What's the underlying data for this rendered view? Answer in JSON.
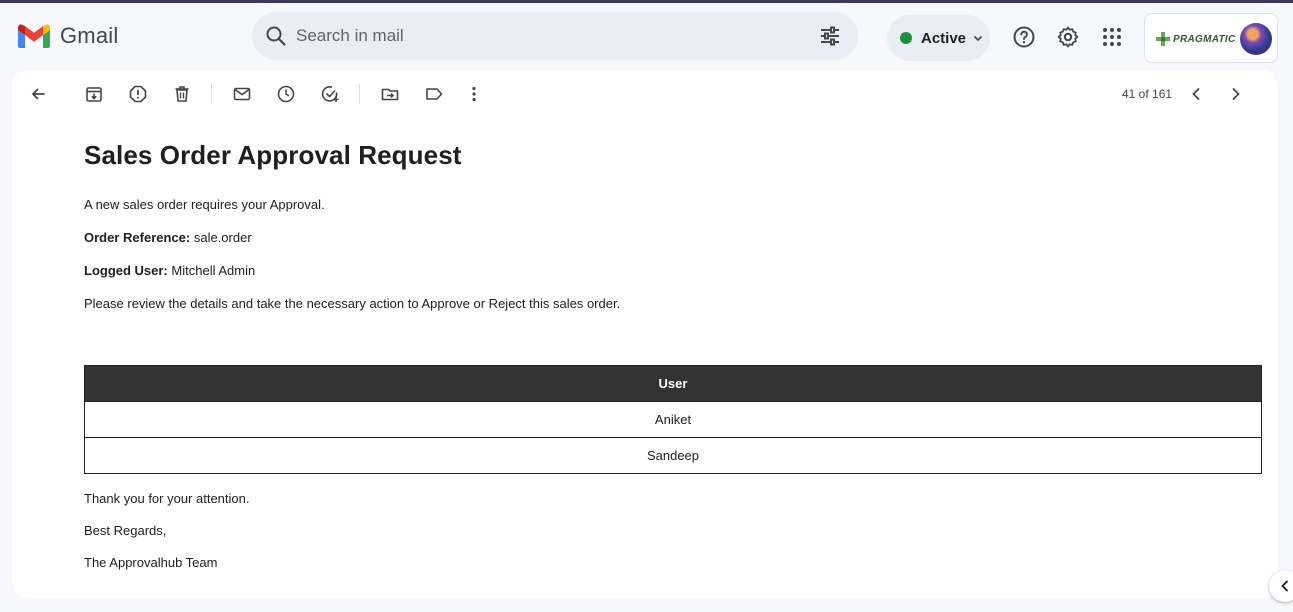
{
  "header": {
    "logo_text": "Gmail",
    "search_placeholder": "Search in mail",
    "status_label": "Active",
    "brand_name": "PRAGMATIC"
  },
  "toolbar": {
    "pager_text": "41 of 161",
    "icons": [
      "back-arrow-icon",
      "archive-icon",
      "report-spam-icon",
      "delete-icon",
      "mark-unread-icon",
      "snooze-icon",
      "add-to-tasks-icon",
      "move-to-icon",
      "label-icon",
      "more-options-icon",
      "newer-chevron-icon",
      "older-chevron-icon"
    ]
  },
  "email": {
    "title": "Sales Order Approval Request",
    "intro": "A new sales order requires your Approval.",
    "order_ref_label": "Order Reference:",
    "order_ref_value": "sale.order",
    "logged_user_label": "Logged User:",
    "logged_user_value": "Mitchell Admin",
    "instruction": "Please review the details and take the necessary action to Approve or Reject this sales order.",
    "table": {
      "header": "User",
      "rows": [
        "Aniket",
        "Sandeep"
      ]
    },
    "thanks": "Thank you for your attention.",
    "regards": "Best Regards,",
    "signature": "The Approvalhub Team"
  },
  "colors": {
    "background": "#f6f8fc",
    "search_bg": "#e9eef6",
    "active_dot": "#1e8e3e",
    "table_header_bg": "#333333"
  }
}
